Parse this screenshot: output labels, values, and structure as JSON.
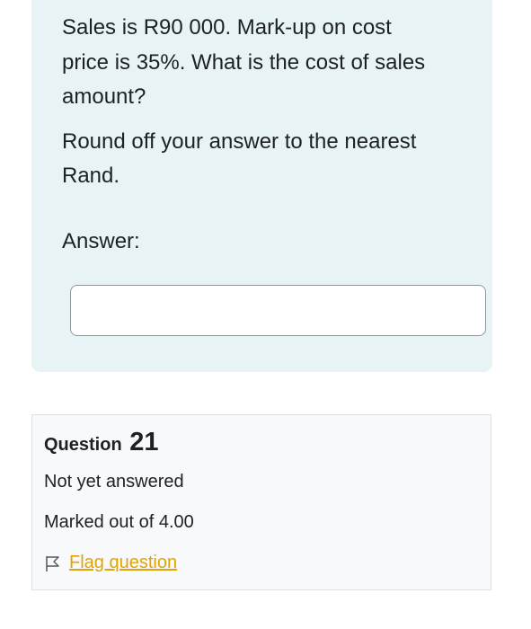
{
  "question": {
    "text_lines": [
      "Sales is R90 000. Mark-up on cost",
      "price is 35%. What is the cost of sales",
      "amount?"
    ],
    "round_lines": [
      "Round off your answer to the nearest",
      "Rand."
    ],
    "answer_label": "Answer:",
    "answer_value": ""
  },
  "info": {
    "question_label": "Question",
    "question_number": "21",
    "state": "Not yet answered",
    "grade": "Marked out of 4.00",
    "flag_label": "Flag question",
    "flag_icon": "flag-icon"
  },
  "colors": {
    "question_bg": "#e7f3f5",
    "info_bg": "#f8f9fa",
    "flag_link": "#e3a300"
  }
}
